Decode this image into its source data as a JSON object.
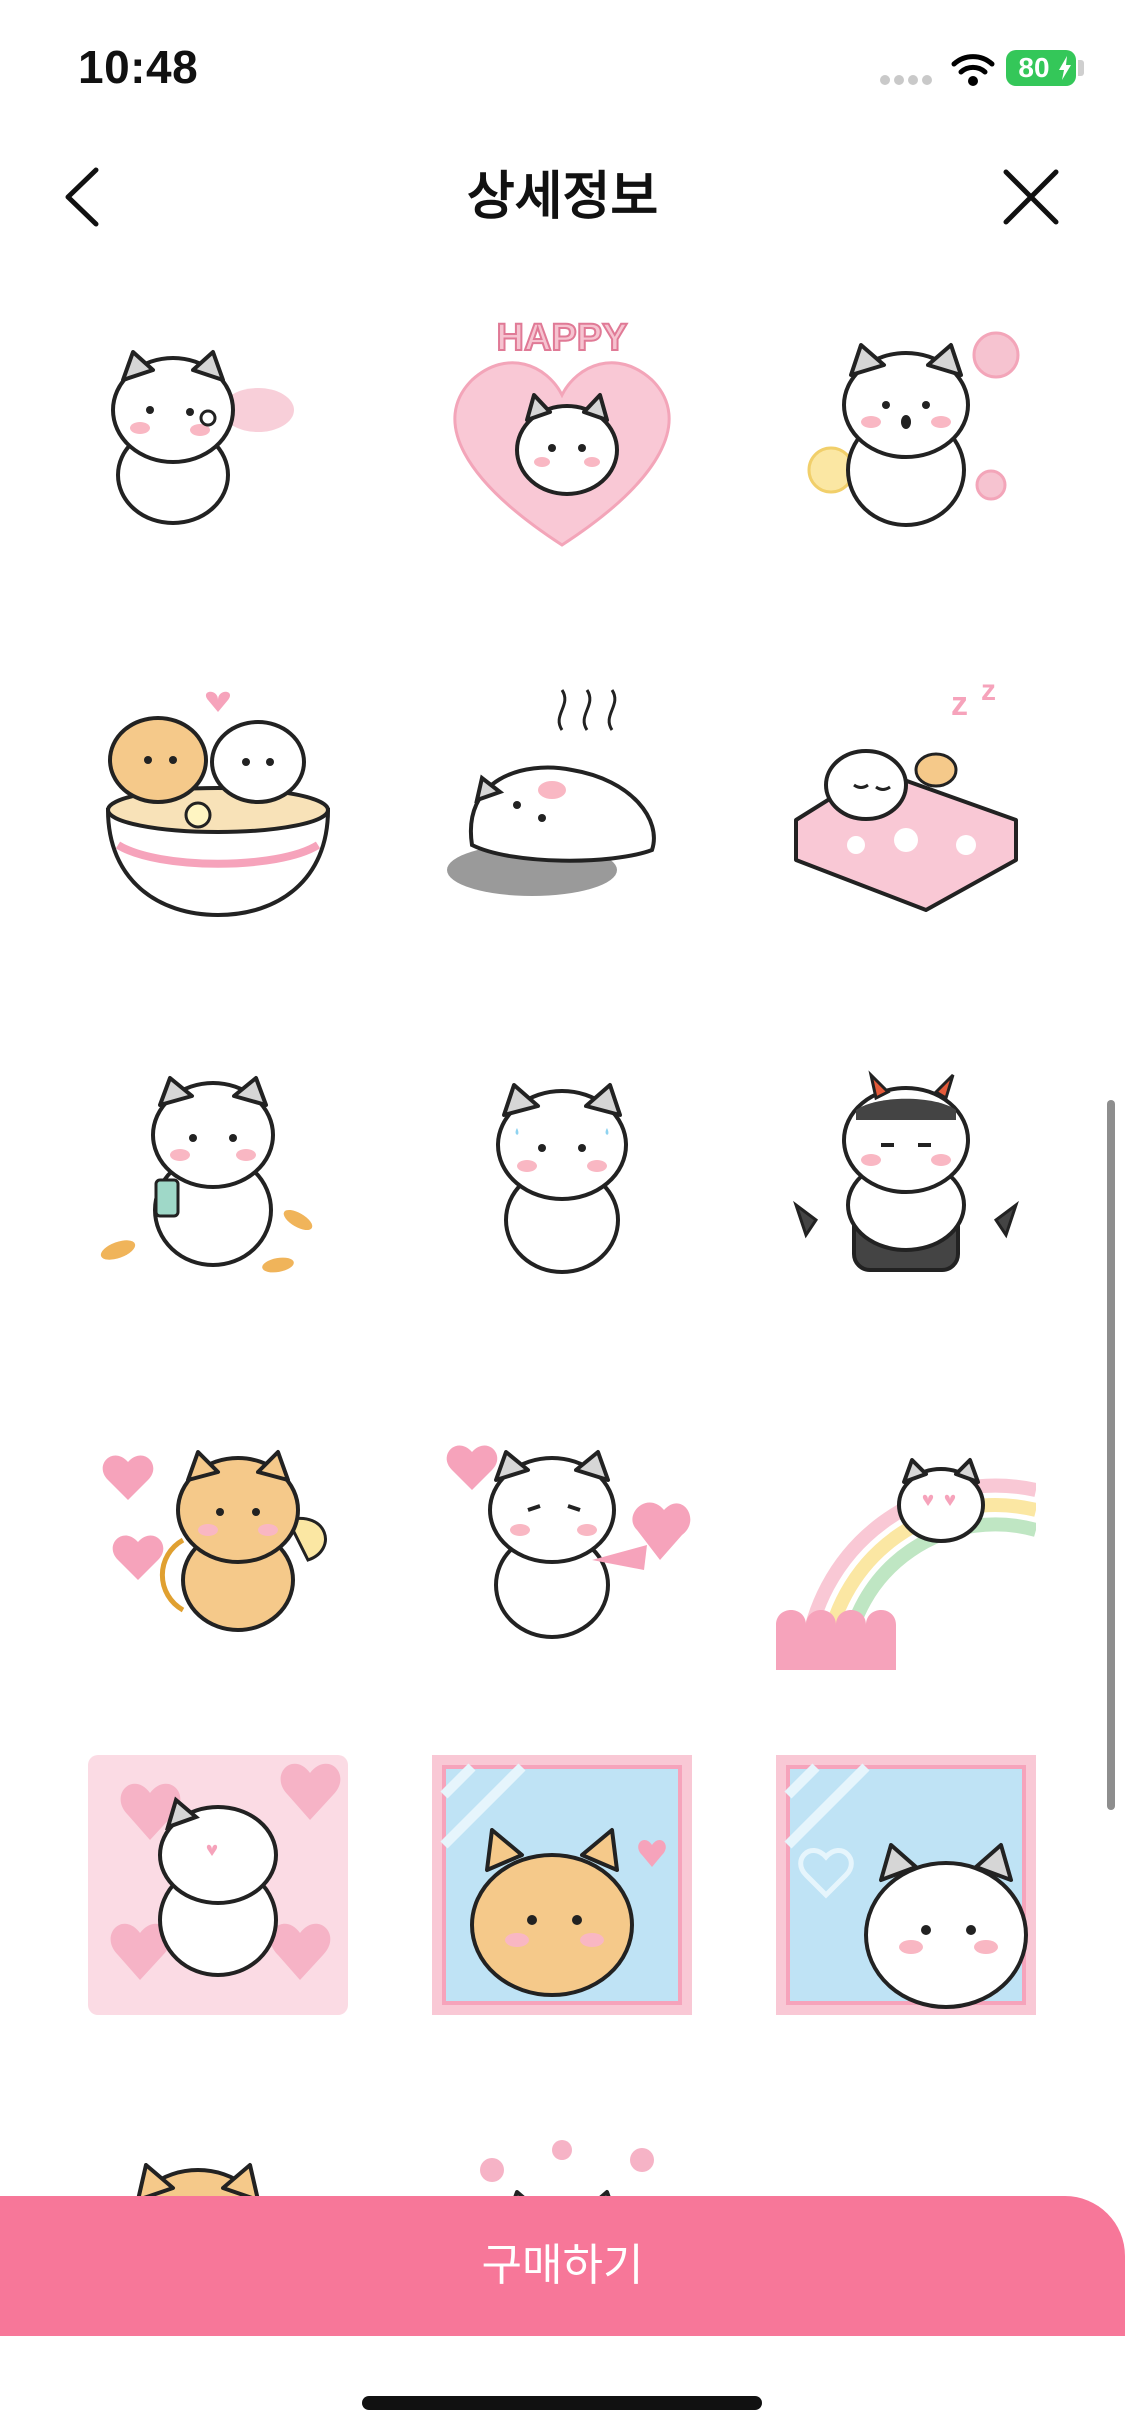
{
  "status": {
    "time": "10:48",
    "battery": "80"
  },
  "nav": {
    "title": "상세정보",
    "back_icon": "chevron-left-icon",
    "close_icon": "close-icon"
  },
  "stickers": [
    {
      "label": "cat-blowing-bubble"
    },
    {
      "label": "happy-heart-cat",
      "text": "HAPPY"
    },
    {
      "label": "cat-surprised-bubbles"
    },
    {
      "label": "cats-in-ramen-bowl"
    },
    {
      "label": "melting-cat"
    },
    {
      "label": "cat-sleeping-in-bed"
    },
    {
      "label": "cat-with-phone-leaves"
    },
    {
      "label": "nervous-cat"
    },
    {
      "label": "devil-cat"
    },
    {
      "label": "cupid-cat"
    },
    {
      "label": "cat-shooting-hearts"
    },
    {
      "label": "cat-on-rainbow"
    },
    {
      "label": "cat-in-hearts"
    },
    {
      "label": "orange-cat-window"
    },
    {
      "label": "white-cat-window"
    },
    {
      "label": "orange-cat-partial"
    },
    {
      "label": "cat-with-flowers-partial"
    }
  ],
  "footer": {
    "buy_label": "구매하기"
  },
  "colors": {
    "accent": "#f77799",
    "cat_outline": "#222222",
    "blush": "#f9b7c3",
    "orange_cat": "#f5c98a",
    "pink": "#f6c3d0",
    "window_blue": "#bfe3f5"
  }
}
